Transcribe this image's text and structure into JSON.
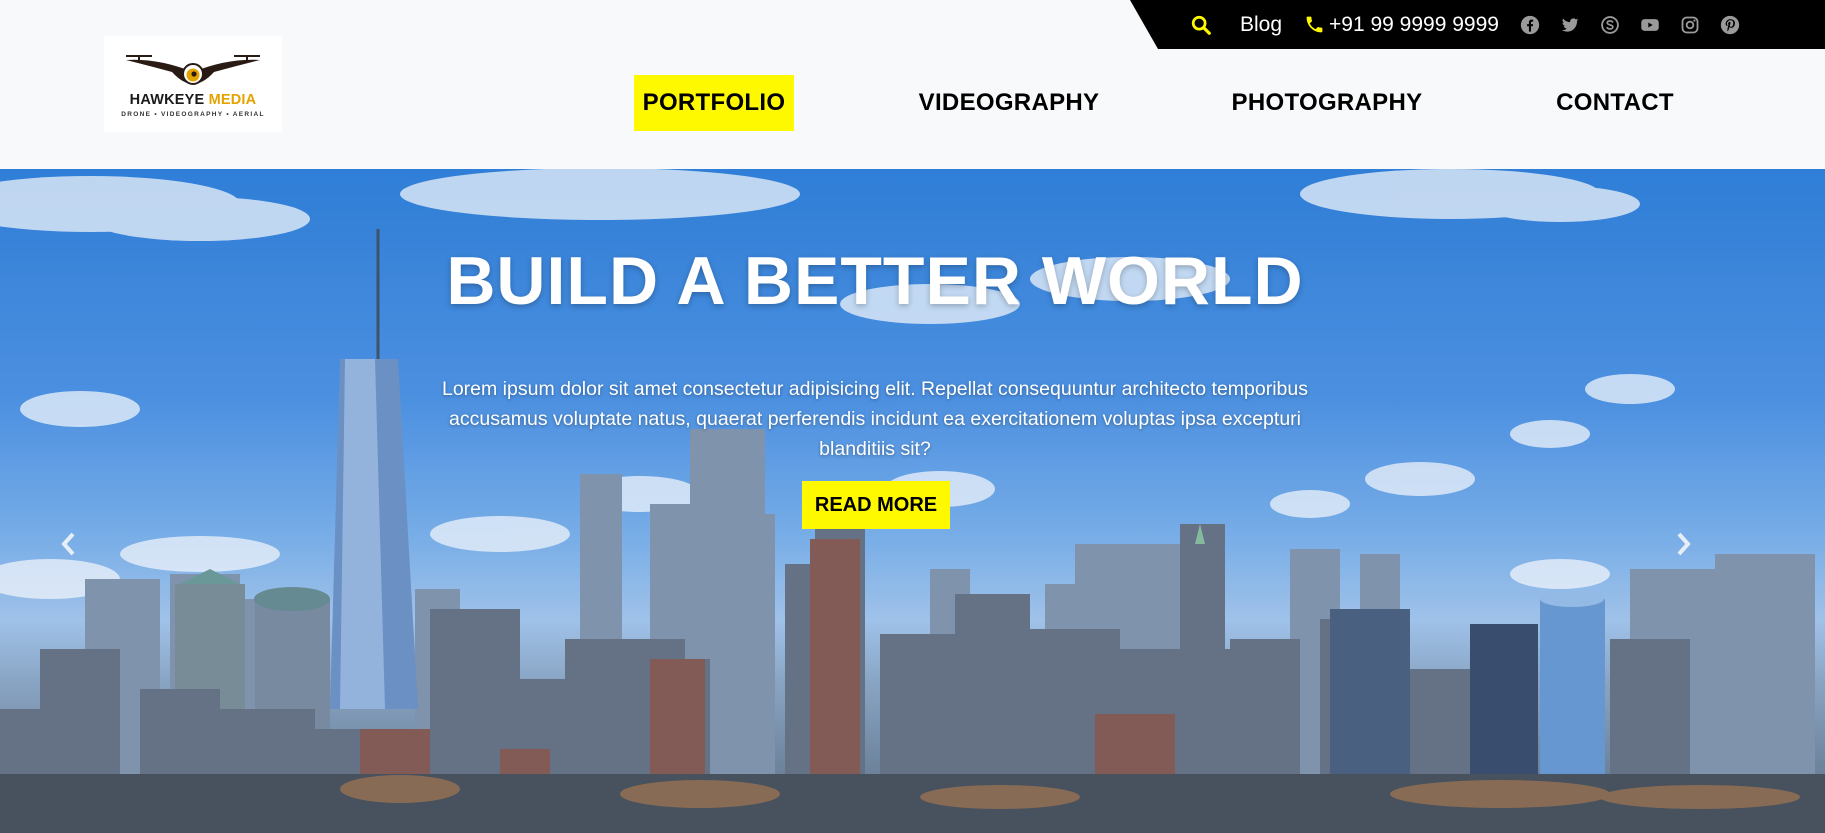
{
  "brand": {
    "name_part1": "HAWKEYE",
    "name_part2": "MEDIA",
    "tagline": "DRONE • VIDEOGRAPHY • AERIAL"
  },
  "topbar": {
    "search_icon": "search-icon",
    "blog_label": "Blog",
    "phone_icon": "phone-icon",
    "phone": "+91 99 9999 9999",
    "social": [
      "facebook-icon",
      "twitter-icon",
      "skype-icon",
      "youtube-icon",
      "instagram-icon",
      "pinterest-icon"
    ]
  },
  "nav": {
    "items": [
      {
        "label": "PORTFOLIO",
        "active": true
      },
      {
        "label": "VIDEOGRAPHY",
        "active": false
      },
      {
        "label": "PHOTOGRAPHY",
        "active": false
      },
      {
        "label": "CONTACT",
        "active": false
      }
    ]
  },
  "hero": {
    "title": "BUILD A BETTER WORLD",
    "text": "Lorem ipsum dolor sit amet consectetur adipisicing elit. Repellat consequuntur architecto temporibus accusamus voluptate natus, quaerat perferendis incidunt ea exercitationem voluptas ipsa excepturi blanditiis sit?",
    "cta_label": "READ MORE",
    "prev_icon": "chevron-left-icon",
    "next_icon": "chevron-right-icon"
  },
  "colors": {
    "accent": "#fff900",
    "topbar_bg": "#000000",
    "header_bg": "#f8f9fa",
    "social_icon": "#9a9a9a"
  }
}
